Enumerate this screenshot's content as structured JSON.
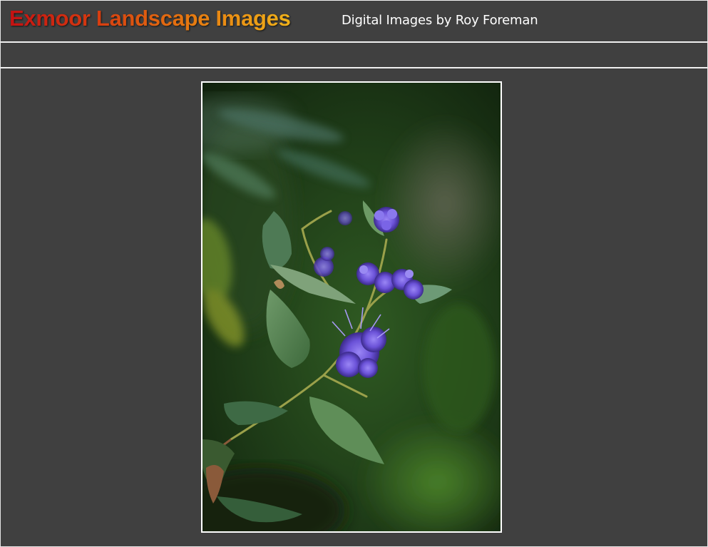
{
  "header": {
    "title": "Exmoor Landscape Images",
    "subtitle": "Digital Images by Roy Foreman"
  },
  "photo": {
    "subject": "flower-photo",
    "colors": {
      "background": "#404040",
      "flower": "#7a5ee0",
      "foliage": "#2f5a2a"
    }
  }
}
